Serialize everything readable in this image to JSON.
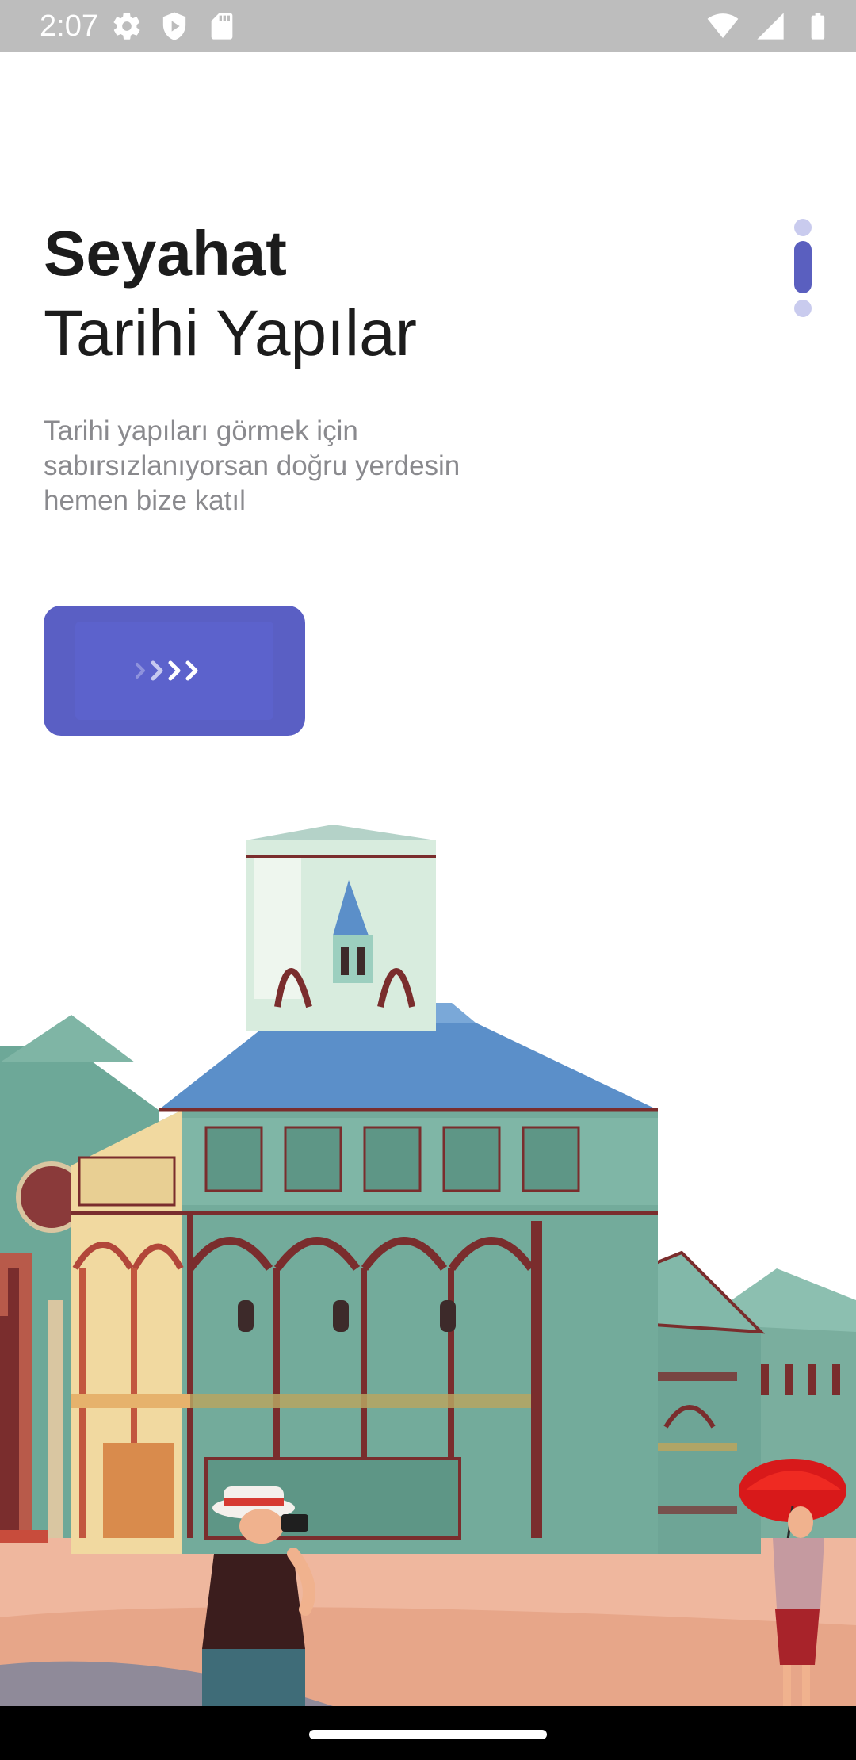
{
  "status_bar": {
    "time": "2:07",
    "left_icons": [
      "settings-icon",
      "play-protect-icon",
      "sd-card-icon"
    ],
    "right_icons": [
      "wifi-icon",
      "cell-signal-icon",
      "battery-icon"
    ]
  },
  "onboarding": {
    "title_bold": "Seyahat",
    "title_regular": "Tarihi Yapılar",
    "description": "Tarihi yapıları görmek için sabırsızlanıyorsan doğru yerdesin hemen bize katıl",
    "page_indicator": {
      "pages": 3,
      "active_index": 1
    },
    "next_button": {
      "icon": "chevron-arrows-icon"
    }
  },
  "colors": {
    "accent": "#5a5fc4",
    "indicator_inactive": "#c9cbee",
    "title_text": "#1c1c1c",
    "description_text": "#8a8a8e",
    "status_bar_bg": "#bdbdbd"
  }
}
